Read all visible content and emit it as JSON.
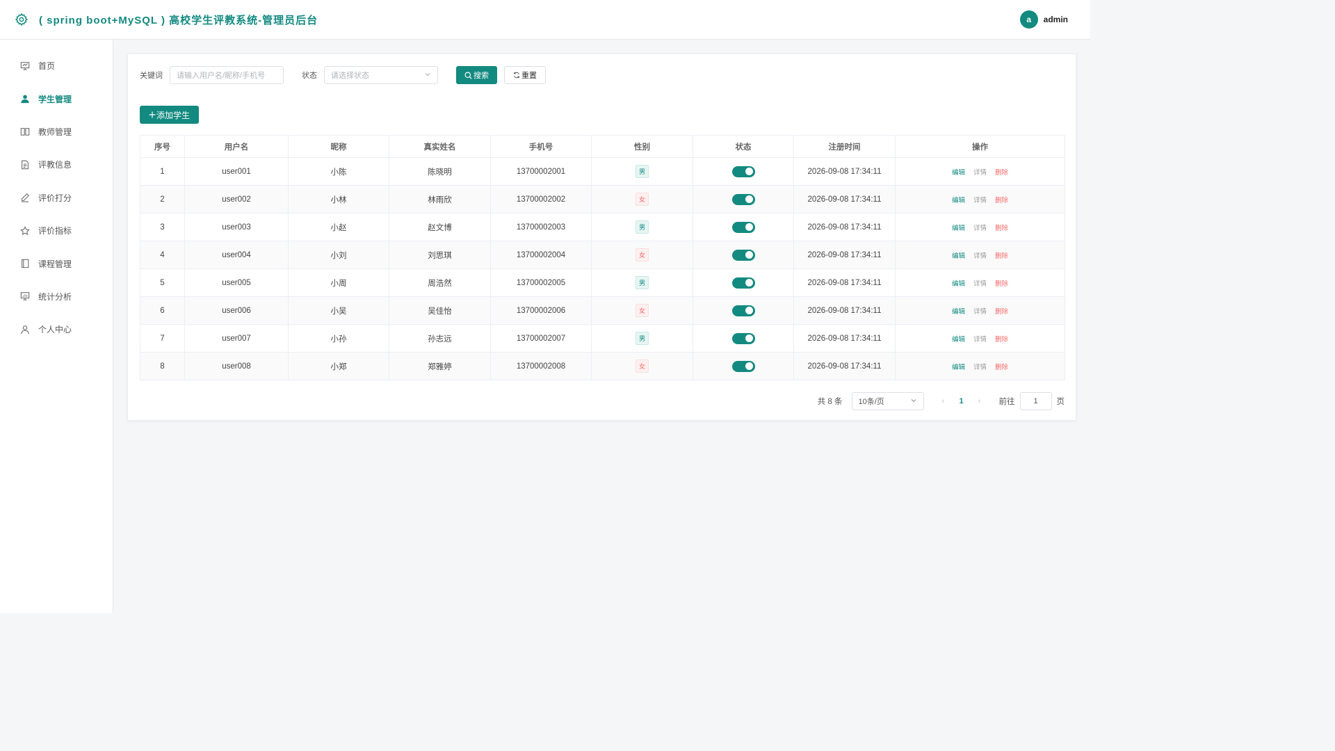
{
  "header": {
    "title": "( spring boot+MySQL ) 高校学生评教系统-管理员后台",
    "logo_icon": "gear-icon",
    "user": {
      "avatar_letter": "a",
      "name": "admin"
    }
  },
  "sidebar": {
    "items": [
      {
        "label": "首页",
        "icon": "chart-board-icon",
        "active": false
      },
      {
        "label": "学生管理",
        "icon": "user-solid-icon",
        "active": true
      },
      {
        "label": "教师管理",
        "icon": "book-icon",
        "active": false
      },
      {
        "label": "评教信息",
        "icon": "document-icon",
        "active": false
      },
      {
        "label": "评价打分",
        "icon": "pen-icon",
        "active": false
      },
      {
        "label": "评价指标",
        "icon": "star-icon",
        "active": false
      },
      {
        "label": "课程管理",
        "icon": "notebook-icon",
        "active": false
      },
      {
        "label": "统计分析",
        "icon": "data-board-icon",
        "active": false
      },
      {
        "label": "个人中心",
        "icon": "user-icon",
        "active": false
      }
    ]
  },
  "filter": {
    "keyword_label": "关键词",
    "keyword_placeholder": "请输入用户名/昵称/手机号",
    "status_label": "状态",
    "status_placeholder": "请选择状态",
    "search_label": "搜索",
    "reset_label": "重置"
  },
  "actions": {
    "add_label": "添加学生"
  },
  "table": {
    "columns": [
      "序号",
      "用户名",
      "昵称",
      "真实姓名",
      "手机号",
      "性别",
      "状态",
      "注册时间",
      "操作"
    ],
    "op_labels": {
      "edit": "编辑",
      "detail": "详情",
      "delete": "删除"
    },
    "rows": [
      {
        "idx": "1",
        "username": "user001",
        "nickname": "小陈",
        "realname": "陈晓明",
        "phone": "13700002001",
        "gender": "男",
        "status_on": true,
        "reg_time": "2026-09-08 17:34:11"
      },
      {
        "idx": "2",
        "username": "user002",
        "nickname": "小林",
        "realname": "林雨欣",
        "phone": "13700002002",
        "gender": "女",
        "status_on": true,
        "reg_time": "2026-09-08 17:34:11"
      },
      {
        "idx": "3",
        "username": "user003",
        "nickname": "小赵",
        "realname": "赵文博",
        "phone": "13700002003",
        "gender": "男",
        "status_on": true,
        "reg_time": "2026-09-08 17:34:11"
      },
      {
        "idx": "4",
        "username": "user004",
        "nickname": "小刘",
        "realname": "刘思琪",
        "phone": "13700002004",
        "gender": "女",
        "status_on": true,
        "reg_time": "2026-09-08 17:34:11"
      },
      {
        "idx": "5",
        "username": "user005",
        "nickname": "小周",
        "realname": "周浩然",
        "phone": "13700002005",
        "gender": "男",
        "status_on": true,
        "reg_time": "2026-09-08 17:34:11"
      },
      {
        "idx": "6",
        "username": "user006",
        "nickname": "小吴",
        "realname": "吴佳怡",
        "phone": "13700002006",
        "gender": "女",
        "status_on": true,
        "reg_time": "2026-09-08 17:34:11"
      },
      {
        "idx": "7",
        "username": "user007",
        "nickname": "小孙",
        "realname": "孙志远",
        "phone": "13700002007",
        "gender": "男",
        "status_on": true,
        "reg_time": "2026-09-08 17:34:11"
      },
      {
        "idx": "8",
        "username": "user008",
        "nickname": "小郑",
        "realname": "郑雅婷",
        "phone": "13700002008",
        "gender": "女",
        "status_on": true,
        "reg_time": "2026-09-08 17:34:11"
      }
    ]
  },
  "pagination": {
    "total_text": "共 8 条",
    "page_size": "10条/页",
    "current_page": "1",
    "goto_label": "前往",
    "goto_value": "1",
    "page_unit": "页"
  },
  "colors": {
    "primary": "#138a80",
    "danger": "#f56c6c"
  }
}
